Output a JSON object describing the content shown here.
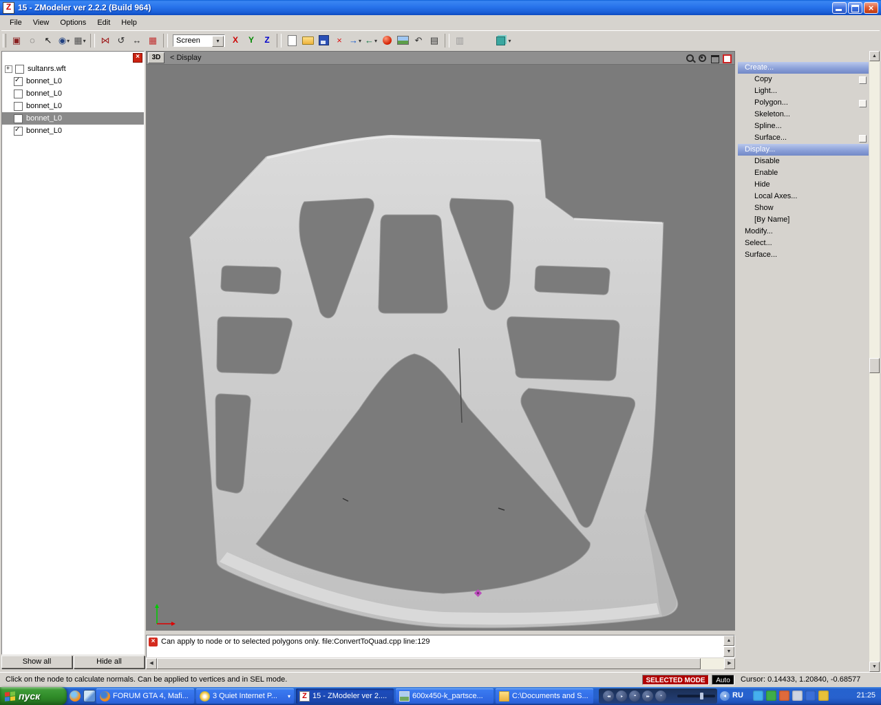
{
  "window": {
    "title": "15 - ZModeler ver 2.2.2 (Build 964)",
    "app_icon": "zmodeler-z-icon"
  },
  "menu": {
    "items": [
      {
        "label": "File"
      },
      {
        "label": "View"
      },
      {
        "label": "Options"
      },
      {
        "label": "Edit"
      },
      {
        "label": "Help"
      }
    ]
  },
  "toolbar": {
    "left_icons": [
      {
        "name": "select-tool-icon",
        "glyph": "▣",
        "color": "#8a2020"
      },
      {
        "name": "lasso-select-icon",
        "glyph": "◌",
        "color": "#303030"
      },
      {
        "name": "cursor-tool-icon",
        "glyph": "↖",
        "color": "#101010"
      },
      {
        "name": "pick-tool-icon",
        "glyph": "◉",
        "color": "#204080",
        "dd": true
      },
      {
        "name": "modes-dropdown-icon",
        "glyph": "▦",
        "color": "#505050",
        "dd": true
      },
      {
        "name": "toolbar-separator",
        "kind": "k-sep"
      },
      {
        "name": "mirror-tool-icon",
        "glyph": "⋈",
        "color": "#a02020"
      },
      {
        "name": "rotate-tool-icon",
        "glyph": "↺",
        "color": "#303030"
      },
      {
        "name": "move-tool-icon",
        "glyph": "↔",
        "color": "#303030"
      },
      {
        "name": "grid-snap-icon",
        "glyph": "▦",
        "color": "#c03030"
      },
      {
        "name": "toolbar-separator",
        "kind": "k-sep"
      }
    ],
    "screen_combo": {
      "value": "Screen"
    },
    "axis_buttons": [
      {
        "name": "axis-x-button",
        "label": "X",
        "color": "#cc0000"
      },
      {
        "name": "axis-y-button",
        "label": "Y",
        "color": "#008800"
      },
      {
        "name": "axis-z-button",
        "label": "Z",
        "color": "#0000cc"
      }
    ],
    "right_icons": [
      {
        "name": "toolbar-separator",
        "kind": "k-sep"
      },
      {
        "name": "new-file-icon",
        "kind": "k-page"
      },
      {
        "name": "open-file-icon",
        "kind": "k-folder"
      },
      {
        "name": "save-file-icon",
        "kind": "k-disk"
      },
      {
        "name": "delete-icon",
        "glyph": "×",
        "color": "#dd1111"
      },
      {
        "name": "import-icon",
        "glyph": "→",
        "color": "#1155cc",
        "dd": true
      },
      {
        "name": "export-icon",
        "glyph": "←",
        "color": "#117744",
        "dd": true
      },
      {
        "name": "material-editor-icon",
        "kind": "k-sphere"
      },
      {
        "name": "texture-browser-icon",
        "kind": "k-image"
      },
      {
        "name": "undo-icon",
        "glyph": "↶",
        "color": "#333333"
      },
      {
        "name": "log-window-icon",
        "glyph": "▤",
        "color": "#333333"
      },
      {
        "name": "toolbar-separator",
        "kind": "k-sep"
      },
      {
        "name": "link-tool-icon",
        "glyph": "▥",
        "color": "#999999"
      },
      {
        "name": "toolbar-gap",
        "kind": "k-gap"
      },
      {
        "name": "view-settings-cube-icon",
        "kind": "k-cube",
        "dd": true
      }
    ]
  },
  "scene_tree": {
    "items": [
      {
        "label": "sultanrs.wft",
        "root": true,
        "checked": false,
        "selected": false
      },
      {
        "label": "bonnet_L0",
        "checked": true,
        "selected": false
      },
      {
        "label": "bonnet_L0",
        "checked": false,
        "selected": false
      },
      {
        "label": "bonnet_L0",
        "checked": false,
        "selected": false
      },
      {
        "label": "bonnet_L0",
        "checked": false,
        "selected": true
      },
      {
        "label": "bonnet_L0",
        "checked": true,
        "selected": false
      }
    ],
    "show_all_label": "Show all",
    "hide_all_label": "Hide all"
  },
  "viewport": {
    "mode_label": "3D",
    "view_label": "< Display",
    "header_icons": [
      {
        "name": "zoom-icon",
        "kind": "vh-zoom"
      },
      {
        "name": "zoom-region-icon",
        "kind": "vh-zoomr"
      },
      {
        "name": "maximize-viewport-icon",
        "kind": "vh-max"
      },
      {
        "name": "viewport-toggle-icon",
        "kind": "vh-red"
      }
    ]
  },
  "command_panel": {
    "items": [
      {
        "label": "Create...",
        "selected": true
      },
      {
        "label": "Copy",
        "indent": true,
        "box": true
      },
      {
        "label": "Light...",
        "indent": true
      },
      {
        "label": "Polygon...",
        "indent": true,
        "box": true
      },
      {
        "label": "Skeleton...",
        "indent": true
      },
      {
        "label": "Spline...",
        "indent": true
      },
      {
        "label": "Surface...",
        "indent": true,
        "box": true
      },
      {
        "label": "Display...",
        "selected": true
      },
      {
        "label": "Disable",
        "indent": true
      },
      {
        "label": "Enable",
        "indent": true
      },
      {
        "label": "Hide",
        "indent": true
      },
      {
        "label": "Local Axes...",
        "indent": true
      },
      {
        "label": "Show",
        "indent": true
      },
      {
        "label": "[By Name]",
        "indent": true
      },
      {
        "label": "Modify..."
      },
      {
        "label": "Select..."
      },
      {
        "label": "Surface..."
      }
    ]
  },
  "message_log": {
    "text": "Can apply to node or to selected polygons only. file:ConvertToQuad.cpp line:129"
  },
  "status_bar": {
    "hint": "Click on the node to calculate normals. Can be applied to vertices and in SEL mode.",
    "mode": "SELECTED MODE",
    "auto": "Auto",
    "cursor": "Cursor: 0.14433, 1.20840, -0.68577"
  },
  "taskbar": {
    "start_label": "пуск",
    "quick_launch": [
      {
        "name": "quicklaunch-firefox-icon"
      },
      {
        "name": "quicklaunch-desktop-icon"
      }
    ],
    "tasks": [
      {
        "label": "FORUM GTA 4, Mafi...",
        "icon": "firefox-icon"
      },
      {
        "label": "3 Quiet Internet P...",
        "icon": "qip-icon",
        "grouped": true
      },
      {
        "label": "15 - ZModeler ver 2....",
        "icon": "zmodeler-icon",
        "active": true
      },
      {
        "label": "600x450-k_partsce...",
        "icon": "image-icon"
      },
      {
        "label": "C:\\Documents and S...",
        "icon": "folder-icon"
      }
    ],
    "media_buttons": [
      {
        "name": "media-prev-icon",
        "glyph": "◂◂"
      },
      {
        "name": "media-play-icon",
        "glyph": "▸"
      },
      {
        "name": "media-pause-icon",
        "glyph": "▪▪"
      },
      {
        "name": "media-next-icon",
        "glyph": "▸▸"
      },
      {
        "name": "media-stop-icon",
        "glyph": "▪"
      }
    ],
    "language_indicator": "RU",
    "tray_icons": [
      {
        "name": "messenger-tray-icon",
        "color": "#45b1ef"
      },
      {
        "name": "antivirus-tray-icon",
        "color": "#3fae49"
      },
      {
        "name": "graphics-tray-icon",
        "color": "#e06a3c"
      },
      {
        "name": "volume-tray-icon",
        "color": "#cfd5e2"
      },
      {
        "name": "network-tray-icon",
        "color": "#3a6fd8"
      },
      {
        "name": "scheduler-tray-icon",
        "color": "#e8c23a"
      }
    ],
    "clock": "21:25"
  }
}
